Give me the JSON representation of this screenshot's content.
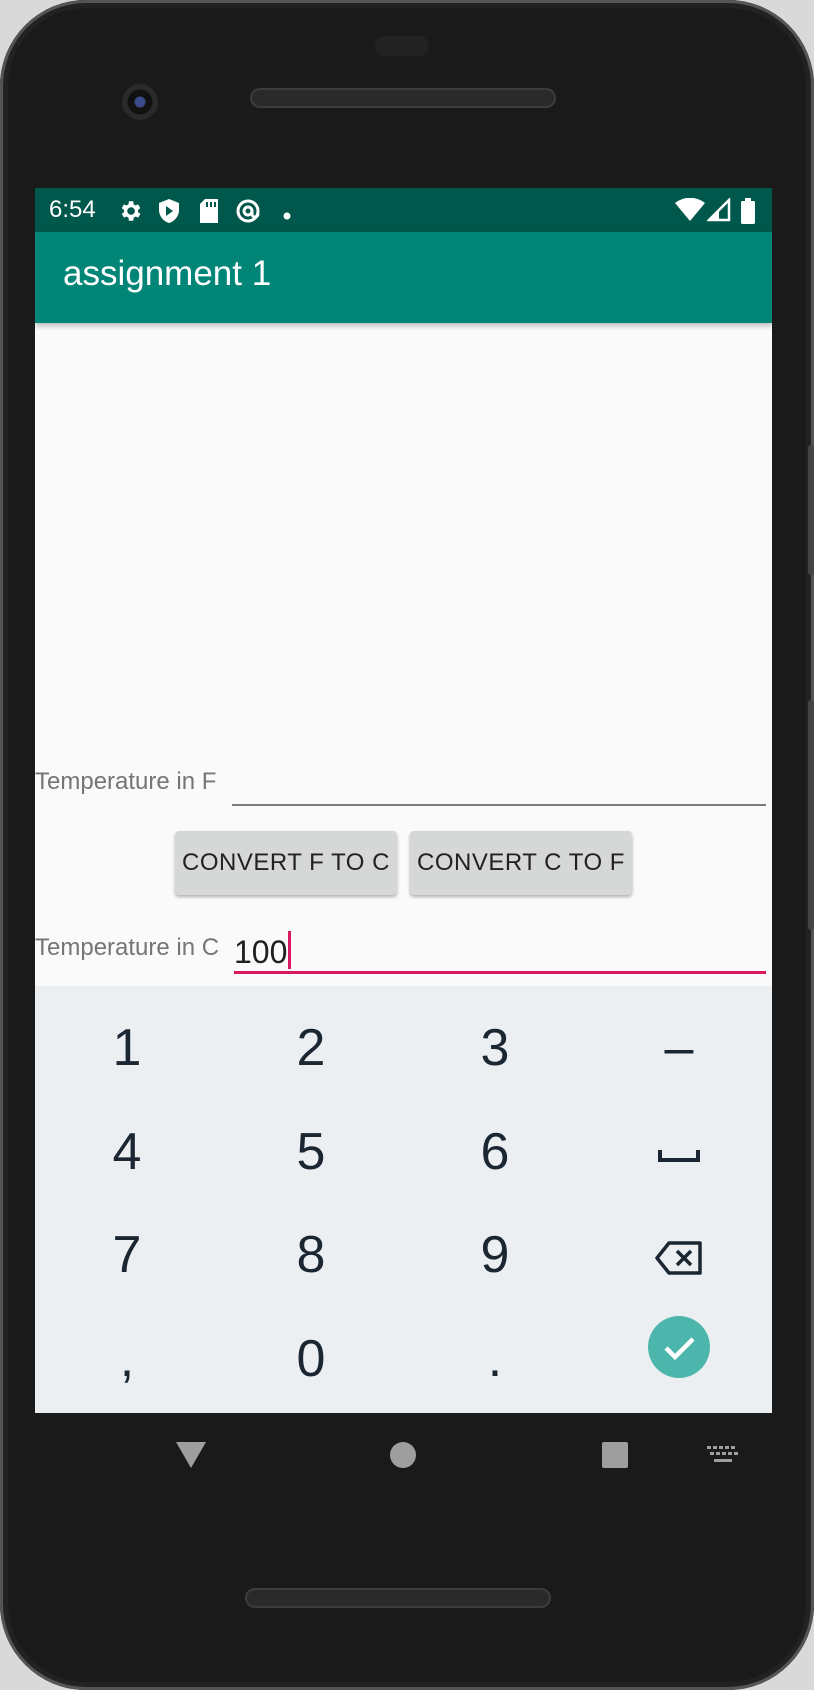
{
  "status_bar": {
    "time": "6:54",
    "left_icons": [
      "gear-icon",
      "shield-icon",
      "sd-card-icon",
      "at-sign-icon",
      "dot-icon"
    ],
    "right_icons": [
      "wifi-icon",
      "signal-icon",
      "battery-icon"
    ]
  },
  "app_bar": {
    "title": "assignment 1"
  },
  "form": {
    "fahrenheit_label": "Temperature in F",
    "fahrenheit_value": "",
    "convert_f_to_c_label": "CONVERT F TO C",
    "convert_c_to_f_label": "CONVERT C TO F",
    "celsius_label": "Temperature in C",
    "celsius_value": "100"
  },
  "keyboard": {
    "rows": [
      [
        "1",
        "2",
        "3",
        "–"
      ],
      [
        "4",
        "5",
        "6",
        "space"
      ],
      [
        "7",
        "8",
        "9",
        "backspace"
      ],
      [
        ",",
        "0",
        ".",
        "done"
      ]
    ]
  },
  "navigation": [
    "back-icon",
    "home-icon",
    "recents-icon",
    "keyboard-switch-icon"
  ],
  "colors": {
    "primary": "#008577",
    "primary_dark": "#00574b",
    "accent": "#d81b60",
    "keyboard_bg": "#eceff1",
    "done_key": "#4db6ac"
  }
}
